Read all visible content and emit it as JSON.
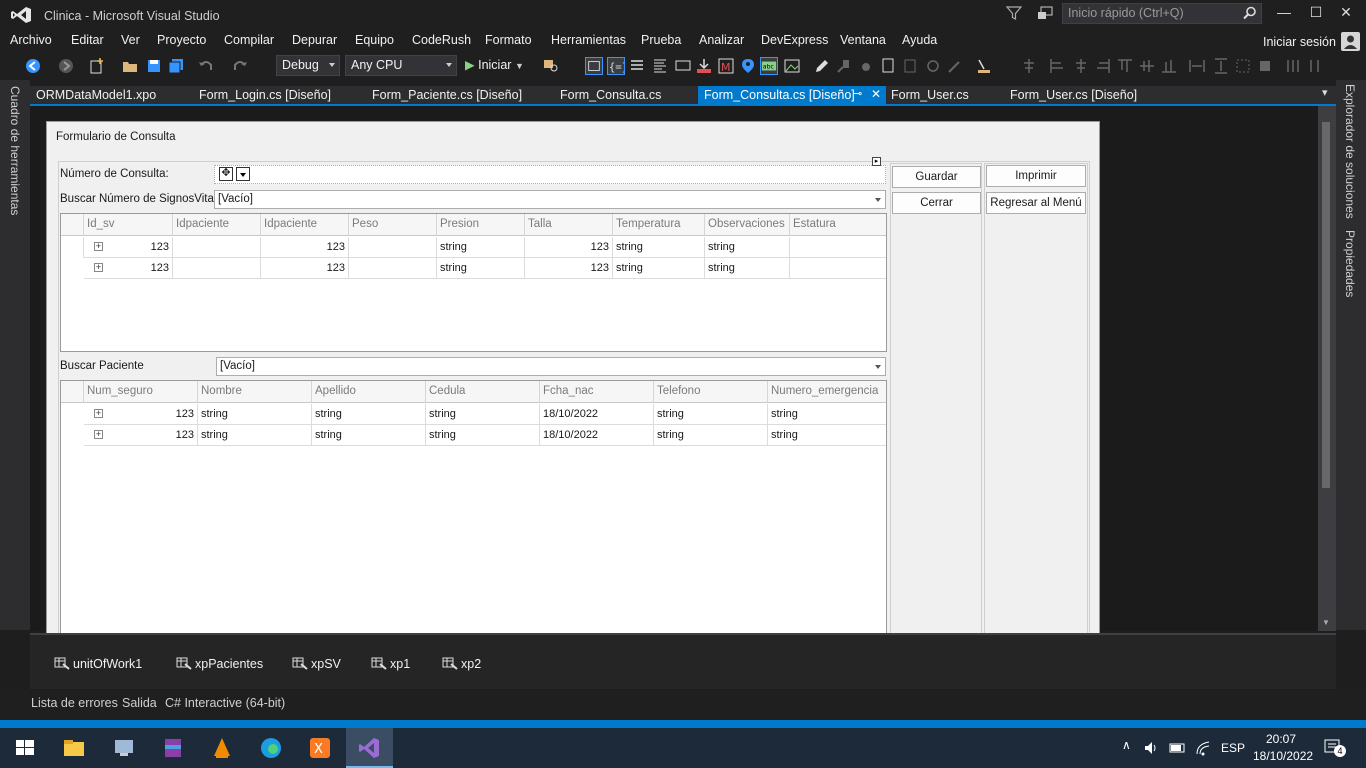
{
  "window": {
    "title": "Clinica - Microsoft Visual Studio"
  },
  "quick_launch": {
    "placeholder": "Inicio rápido (Ctrl+Q)"
  },
  "menu": [
    "Archivo",
    "Editar",
    "Ver",
    "Proyecto",
    "Compilar",
    "Depurar",
    "Equipo",
    "CodeRush",
    "Formato",
    "Herramientas",
    "Prueba",
    "Analizar",
    "DevExpress",
    "Ventana",
    "Ayuda"
  ],
  "sign_in": "Iniciar sesión",
  "toolbar": {
    "config": "Debug",
    "platform": "Any CPU",
    "start": "Iniciar"
  },
  "left_panel": "Cuadro de herramientas",
  "right_panel": {
    "solution": "Explorador de soluciones",
    "properties": "Propiedades"
  },
  "tabs": [
    {
      "label": "ORMDataModel1.xpo"
    },
    {
      "label": "Form_Login.cs [Diseño]"
    },
    {
      "label": "Form_Paciente.cs [Diseño]"
    },
    {
      "label": "Form_Consulta.cs"
    },
    {
      "label": "Form_Consulta.cs [Diseño]"
    },
    {
      "label": "Form_User.cs"
    },
    {
      "label": "Form_User.cs [Diseño]"
    }
  ],
  "form": {
    "title": "Formulario de Consulta",
    "numero_consulta_label": "Número de Consulta:",
    "buscar_sv_label": "Buscar Número de SignosVitales",
    "buscar_sv_value": "[Vacío]",
    "buscar_paciente_label": "Buscar Paciente",
    "buscar_paciente_value": "[Vacío]",
    "buttons": {
      "guardar": "Guardar",
      "imprimir": "Imprimir",
      "cerrar": "Cerrar",
      "regresar": "Regresar al Menú"
    },
    "grid_sv": {
      "columns": [
        "Id_sv",
        "Idpaciente",
        "Idpaciente",
        "Peso",
        "Presion",
        "Talla",
        "Temperatura",
        "Observaciones",
        "Estatura"
      ],
      "rows": [
        [
          "123",
          "",
          "123",
          "",
          "string",
          "123",
          "string",
          "string",
          ""
        ],
        [
          "123",
          "",
          "123",
          "",
          "string",
          "123",
          "string",
          "string",
          ""
        ]
      ]
    },
    "grid_pac": {
      "columns": [
        "Num_seguro",
        "Nombre",
        "Apellido",
        "Cedula",
        "Fcha_nac",
        "Telefono",
        "Numero_emergencia"
      ],
      "rows": [
        [
          "123",
          "string",
          "string",
          "string",
          "18/10/2022",
          "string",
          "string"
        ],
        [
          "123",
          "string",
          "string",
          "string",
          "18/10/2022",
          "string",
          "string"
        ]
      ]
    }
  },
  "tray": [
    "unitOfWork1",
    "xpPacientes",
    "xpSV",
    "xp1",
    "xp2"
  ],
  "bottom_tabs": [
    "Lista de errores",
    "Salida",
    "C# Interactive (64-bit)"
  ],
  "taskbar": {
    "lang": "ESP",
    "time": "20:07",
    "date": "18/10/2022",
    "notifications": "4"
  }
}
